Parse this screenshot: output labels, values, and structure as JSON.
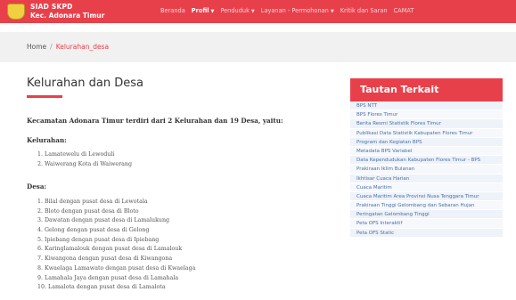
{
  "brand": {
    "line1": "SIAD SKPD",
    "line2": "Kec. Adonara Timur"
  },
  "nav": {
    "items": [
      {
        "label": "Beranda",
        "active": false,
        "caret": false
      },
      {
        "label": "Profil",
        "active": true,
        "caret": true
      },
      {
        "label": "Penduduk",
        "active": false,
        "caret": true
      },
      {
        "label": "Layanan - Permohonan",
        "active": false,
        "caret": true
      },
      {
        "label": "Kritik dan Saran",
        "active": false,
        "caret": false
      },
      {
        "label": "CAMAT",
        "active": false,
        "caret": false
      }
    ],
    "caret_glyph": "▼"
  },
  "breadcrumb": {
    "home": "Home",
    "separator": "/",
    "current": "Kelurahan_desa"
  },
  "main": {
    "title": "Kelurahan dan Desa",
    "intro": "Kecamatan Adonara Timur terdiri dari 2 Kelurahan dan 19 Desa, yaitu:",
    "kelurahan_heading": "Kelurahan:",
    "kelurahan": [
      "1. Lamatewelu di Lewoduli",
      "2. Waiwerang Kota di Waiwerang"
    ],
    "desa_heading": "Desa:",
    "desa": [
      "1. Bilal dengan pusat desa di Lewotala",
      "2. Bloto dengan pusat desa di Bloto",
      "3. Dawatan dengan pusat desa di Lamalukung",
      "4. Gelong dengan pusat desa di Gelong",
      "5. Ipiebang dengan pusat desa di Ipiebang",
      "6. Karinglamalouk dengan pusat desa di Lamalouk",
      "7. Kiwangona dengan pusat desa di Kiwangona",
      "8. Kwaelaga Lamawato dengan pusat desa di Kwaelaga",
      "9. Lamahala Jaya dengan pusat desa di Lamahala",
      "10. Lamalota dengan pusat desa di Lamalota"
    ]
  },
  "sidebar": {
    "title": "Tautan Terkait",
    "links": [
      "BPS NTT",
      "BPS Flores Timur",
      "Berita Resmi Statistik Flores Timur",
      "Publikasi Data Statistik Kabupaten Flores Timur",
      "Program dan Kegiatan BPS",
      "Metadata BPS Variabel",
      "Data Kependudukan Kabupaten Flores Timur - BPS",
      "Prakiraan Iklim Bulanan",
      "Ikhtisar Cuaca Harian",
      "Cuaca Maritim",
      "Cuaca Maritim Area Provinsi Nusa Tenggara Timur",
      "Prakiraan Tinggi Gelombang dan Sebaran Hujan",
      "Peringatan Gelombang Tinggi",
      "Peta OFS Interaktif",
      "Peta OFS Static"
    ]
  },
  "colors": {
    "accent": "#e8404a",
    "link": "#4a6fa5"
  }
}
